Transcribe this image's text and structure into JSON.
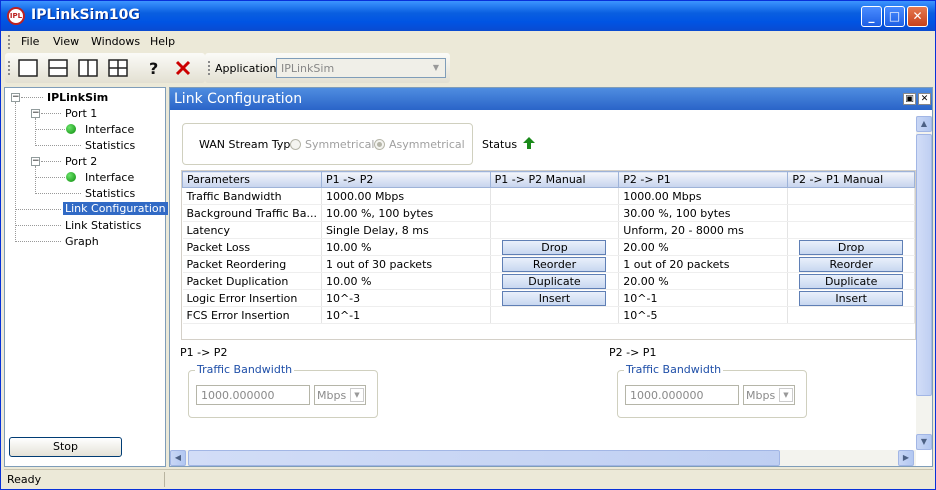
{
  "window": {
    "title": "IPLinkSim10G",
    "app_icon_text": "IPL"
  },
  "menu": [
    "File",
    "View",
    "Windows",
    "Help"
  ],
  "toolbar": {
    "application_label": "Application:",
    "application_value": "IPLinkSim"
  },
  "tree": {
    "root": "IPLinkSim",
    "port1": "Port 1",
    "port1_interface": "Interface",
    "port1_statistics": "Statistics",
    "port2": "Port 2",
    "port2_interface": "Interface",
    "port2_statistics": "Statistics",
    "link_configuration": "Link Configuration",
    "link_statistics": "Link Statistics",
    "graph": "Graph"
  },
  "stop_button": "Stop",
  "panel": {
    "title": "Link Configuration"
  },
  "wan": {
    "label": "WAN Stream Type",
    "symmetrical": "Symmetrical",
    "asymmetrical": "Asymmetrical",
    "status_label": "Status"
  },
  "grid": {
    "headers": [
      "Parameters",
      "P1 -> P2",
      "P1 -> P2 Manual",
      "P2 -> P1",
      "P2 -> P1 Manual"
    ],
    "rows": [
      {
        "param": "Traffic Bandwidth",
        "p1p2": "1000.00 Mbps",
        "m1": "",
        "p2p1": "1000.00 Mbps",
        "m2": ""
      },
      {
        "param": "Background Traffic Ba...",
        "p1p2": "10.00 %, 100 bytes",
        "m1": "",
        "p2p1": "30.00 %, 100 bytes",
        "m2": ""
      },
      {
        "param": "Latency",
        "p1p2": "Single Delay, 8 ms",
        "m1": "",
        "p2p1": "Unform, 20 - 8000 ms",
        "m2": ""
      },
      {
        "param": "Packet Loss",
        "p1p2": "10.00 %",
        "m1": "Drop",
        "p2p1": "20.00 %",
        "m2": "Drop"
      },
      {
        "param": "Packet Reordering",
        "p1p2": "1 out of 30 packets",
        "m1": "Reorder",
        "p2p1": "1 out of 20 packets",
        "m2": "Reorder"
      },
      {
        "param": "Packet Duplication",
        "p1p2": "10.00 %",
        "m1": "Duplicate",
        "p2p1": "20.00 %",
        "m2": "Duplicate"
      },
      {
        "param": "Logic Error Insertion",
        "p1p2": "10^-3",
        "m1": "Insert",
        "p2p1": "10^-1",
        "m2": "Insert"
      },
      {
        "param": "FCS Error Insertion",
        "p1p2": "10^-1",
        "m1": "",
        "p2p1": "10^-5",
        "m2": ""
      }
    ]
  },
  "bw_p1": {
    "section": "P1 -> P2",
    "title": "Traffic Bandwidth",
    "value": "1000.000000",
    "unit": "Mbps"
  },
  "bw_p2": {
    "section": "P2 -> P1",
    "title": "Traffic Bandwidth",
    "value": "1000.000000",
    "unit": "Mbps"
  },
  "status_bar": {
    "text": "Ready"
  },
  "colors": {
    "titlebar": "#0054e3",
    "selection": "#316ac5",
    "status_ok": "#1a8a1a"
  }
}
